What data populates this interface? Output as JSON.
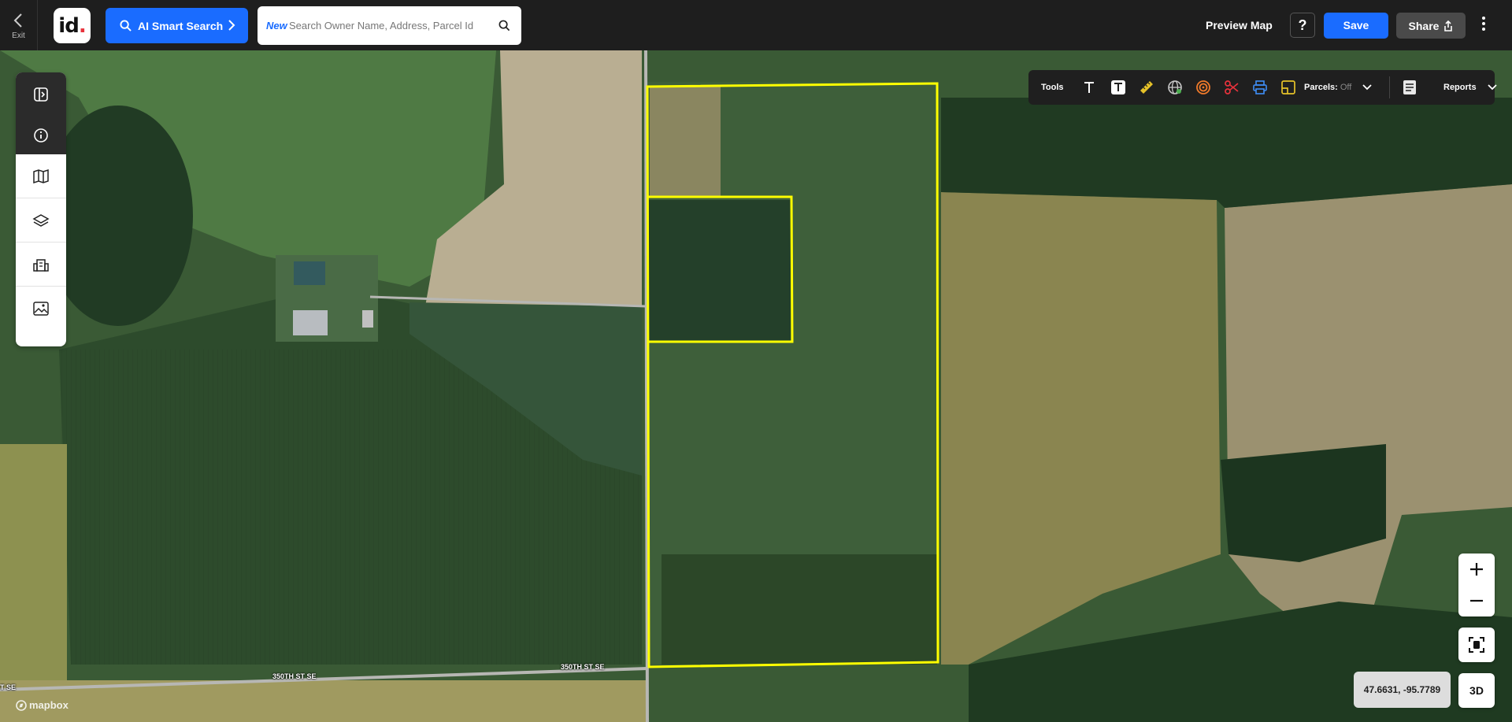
{
  "topbar": {
    "exit_label": "Exit",
    "logo_text": "id",
    "logo_dot": ".",
    "ai_search_label": "AI Smart Search",
    "search_badge": "New",
    "search_placeholder": "Search Owner Name, Address, Parcel Id",
    "preview_label": "Preview Map",
    "help_label": "?",
    "save_label": "Save",
    "share_label": "Share"
  },
  "tools": {
    "tools_label": "Tools",
    "parcels_label": "Parcels:",
    "parcels_state": "Off",
    "reports_label": "Reports"
  },
  "map": {
    "roads": [
      {
        "label": "350TH ST SE"
      },
      {
        "label": "350TH ST SE"
      },
      {
        "label": "T SE"
      }
    ],
    "coordinates": "47.6631, -95.7789",
    "btn_3d": "3D",
    "attribution": "mapbox",
    "parcel_outline_color": "#ffff00"
  },
  "colors": {
    "accent": "#1a6cff",
    "brand_dot": "#e8323c",
    "topbar_bg": "#1e1e1e"
  }
}
